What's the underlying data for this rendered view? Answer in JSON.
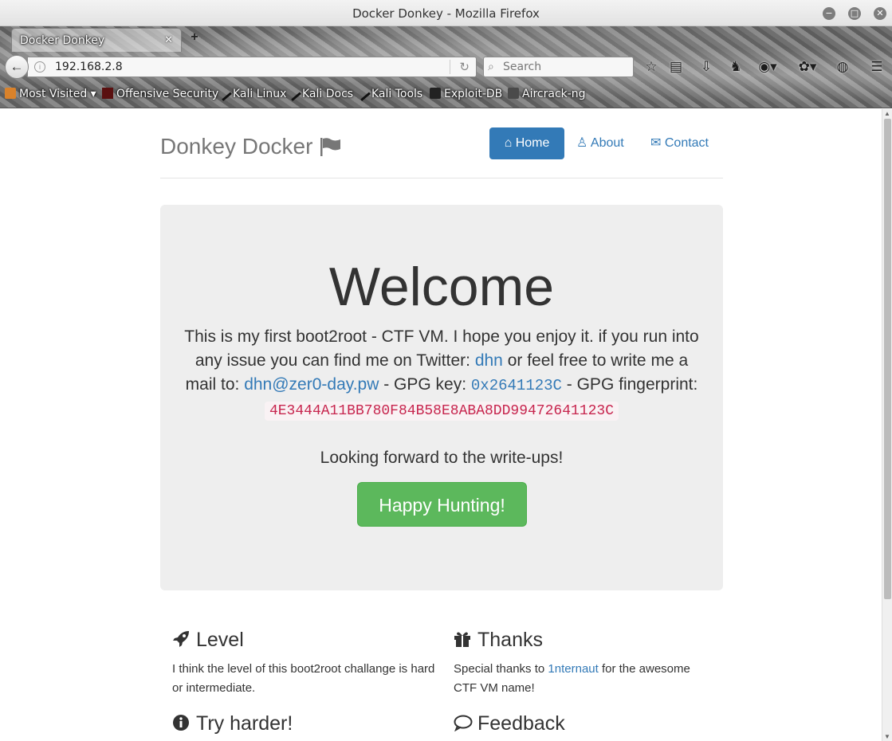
{
  "window": {
    "title": "Docker Donkey - Mozilla Firefox"
  },
  "tab": {
    "label": "Docker Donkey",
    "close_glyph": "✕",
    "new_tab_glyph": "+"
  },
  "toolbar": {
    "url": "192.168.2.8",
    "search_placeholder": "Search"
  },
  "bookmarks": [
    {
      "label": "Most Visited",
      "icon": "folder-icon"
    },
    {
      "label": "Offensive Security",
      "icon": "offsec-icon"
    },
    {
      "label": "Kali Linux",
      "icon": "kali-icon"
    },
    {
      "label": "Kali Docs",
      "icon": "kali-icon"
    },
    {
      "label": "Kali Tools",
      "icon": "kali-icon"
    },
    {
      "label": "Exploit-DB",
      "icon": "exploitdb-icon"
    },
    {
      "label": "Aircrack-ng",
      "icon": "aircrack-icon"
    }
  ],
  "site": {
    "brand": "Donkey Docker",
    "nav": {
      "home": "Home",
      "about": "About",
      "contact": "Contact"
    }
  },
  "jumbotron": {
    "heading": "Welcome",
    "intro_1": "This is my first boot2root - CTF VM. I hope you enjoy it. if you run into any issue you can find me on Twitter: ",
    "twitter_link": "dhn",
    "intro_2": " or feel free to write me a mail to: ",
    "email_link": "dhn@zer0-day.pw",
    "intro_3": " - GPG key: ",
    "gpg_key": "0x2641123C",
    "intro_4": " - GPG fingerprint: ",
    "gpg_fingerprint": "4E3444A11BB780F84B58E8ABA8DD99472641123C",
    "looking_forward": "Looking forward to the write-ups!",
    "button": "Happy Hunting!"
  },
  "features": {
    "level": {
      "title": "Level",
      "text": "I think the level of this boot2root challange is hard or intermediate."
    },
    "thanks": {
      "title": "Thanks",
      "text_1": "Special thanks to ",
      "link": "1nternaut",
      "text_2": " for the awesome CTF VM name!"
    },
    "try_harder": {
      "title": "Try harder!"
    },
    "feedback": {
      "title": "Feedback"
    }
  },
  "colors": {
    "primary": "#337ab7",
    "success": "#5cb85c",
    "code_red": "#c7254e"
  }
}
